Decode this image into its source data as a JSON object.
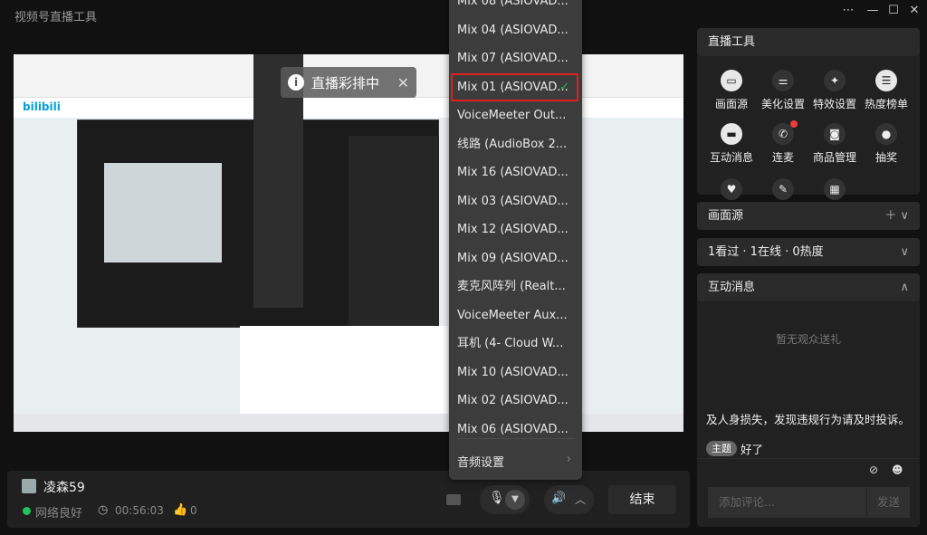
{
  "window": {
    "title": "视频号直播工具",
    "controls": [
      "more",
      "minimize",
      "maximize",
      "close"
    ]
  },
  "preview": {
    "overlay_label": "直播彩排中",
    "site_logo": "bilibili"
  },
  "dropdown": {
    "items": [
      {
        "label": "Mix 08 (ASIOVAD...",
        "selected": false
      },
      {
        "label": "Mix 04 (ASIOVAD...",
        "selected": false
      },
      {
        "label": "Mix 07 (ASIOVAD...",
        "selected": false
      },
      {
        "label": "Mix 01 (ASIOVAD...",
        "selected": true
      },
      {
        "label": "VoiceMeeter Out...",
        "selected": false
      },
      {
        "label": "线路 (AudioBox 2...",
        "selected": false
      },
      {
        "label": "Mix 16 (ASIOVAD...",
        "selected": false
      },
      {
        "label": "Mix 03 (ASIOVAD...",
        "selected": false
      },
      {
        "label": "Mix 12 (ASIOVAD...",
        "selected": false
      },
      {
        "label": "Mix 09 (ASIOVAD...",
        "selected": false
      },
      {
        "label": "麦克风阵列 (Realt...",
        "selected": false
      },
      {
        "label": "VoiceMeeter Aux...",
        "selected": false
      },
      {
        "label": "耳机 (4- Cloud W...",
        "selected": false
      },
      {
        "label": "Mix 10 (ASIOVAD...",
        "selected": false
      },
      {
        "label": "Mix 02 (ASIOVAD...",
        "selected": false
      },
      {
        "label": "Mix 06 (ASIOVAD...",
        "selected": false
      }
    ],
    "settings_label": "音频设置",
    "check_color": "#28b463",
    "highlight_color": "#e02020"
  },
  "bottom": {
    "streamer": "凌森59",
    "network": "网络良好",
    "duration": "00:56:03",
    "likes": "0",
    "end_label": "结束",
    "status_color": "#1fc45a"
  },
  "tools": {
    "title": "直播工具",
    "items": [
      {
        "label": "画面源",
        "icon": "screen-icon"
      },
      {
        "label": "美化设置",
        "icon": "sliders-icon"
      },
      {
        "label": "特效设置",
        "icon": "sparkle-icon"
      },
      {
        "label": "热度榜单",
        "icon": "list-icon"
      },
      {
        "label": "互动消息",
        "icon": "message-icon"
      },
      {
        "label": "连麦",
        "icon": "phone-icon",
        "badge": true
      },
      {
        "label": "商品管理",
        "icon": "bag-icon"
      },
      {
        "label": "抽奖",
        "icon": "lottery-icon"
      }
    ]
  },
  "source_panel": {
    "title": "画面源"
  },
  "stats_panel": {
    "title": "1看过 · 1在线 · 0热度"
  },
  "messages": {
    "title": "互动消息",
    "empty": "暂无观众送礼",
    "rule_text": "及人身损失，发现违规行为请及时投诉。",
    "topic_tag": "主题",
    "topic_text": "好了",
    "input_placeholder": "添加评论...",
    "send_label": "发送"
  }
}
